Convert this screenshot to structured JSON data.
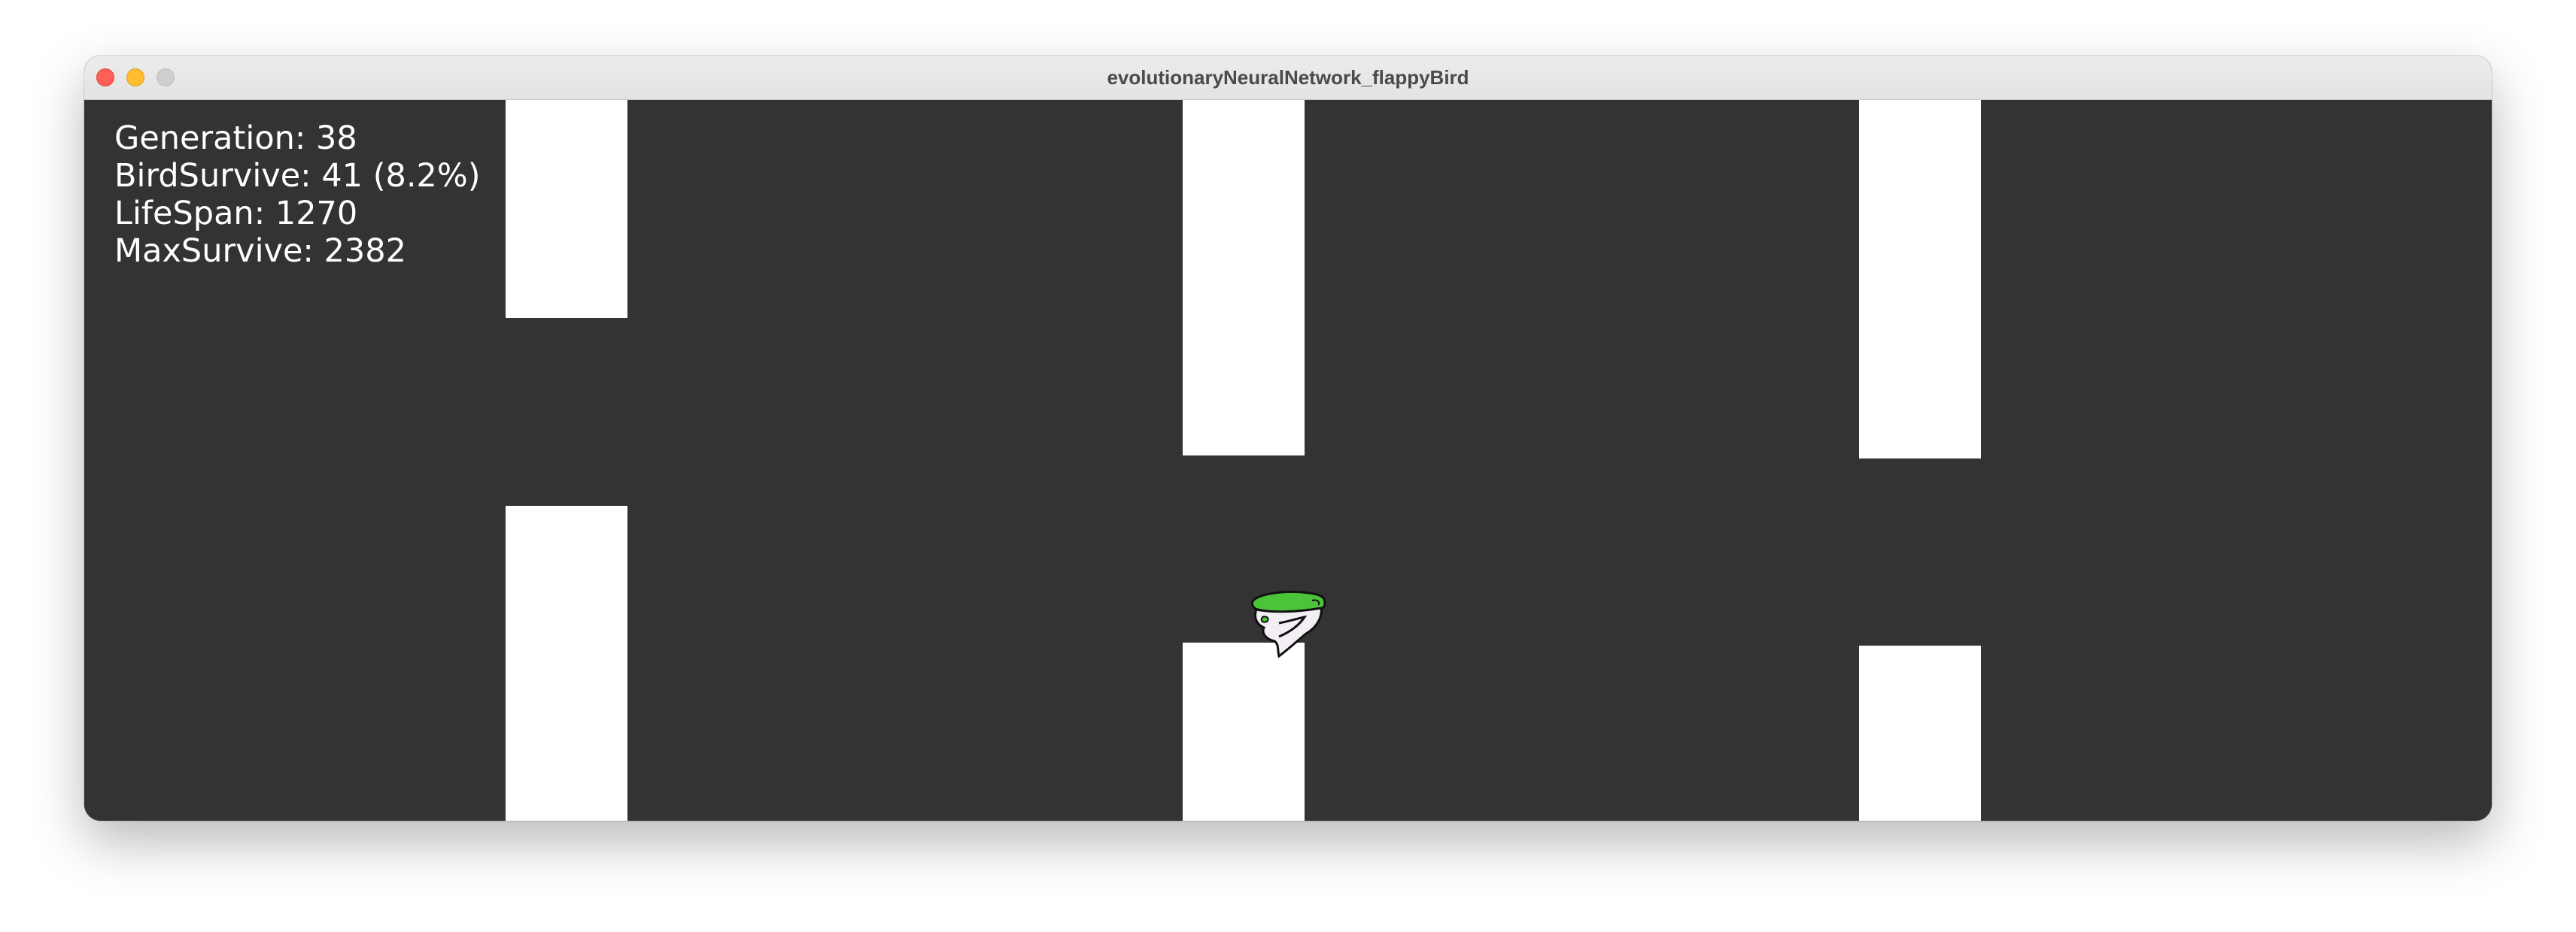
{
  "window": {
    "title": "evolutionaryNeuralNetwork_flappyBird"
  },
  "hud": {
    "generation": "Generation: 38",
    "bird_survive": "BirdSurvive: 41 (8.2%)",
    "life_span": "LifeSpan: 1270",
    "max_survive": "MaxSurvive: 2382"
  },
  "colors": {
    "background": "#333333",
    "pipe": "#ffffff",
    "bird_top": "#4cc43a",
    "bird_body": "#f2eef4",
    "hud_text": "#ffffff"
  },
  "icons": {
    "bird": "flappy-bird-sprite"
  }
}
